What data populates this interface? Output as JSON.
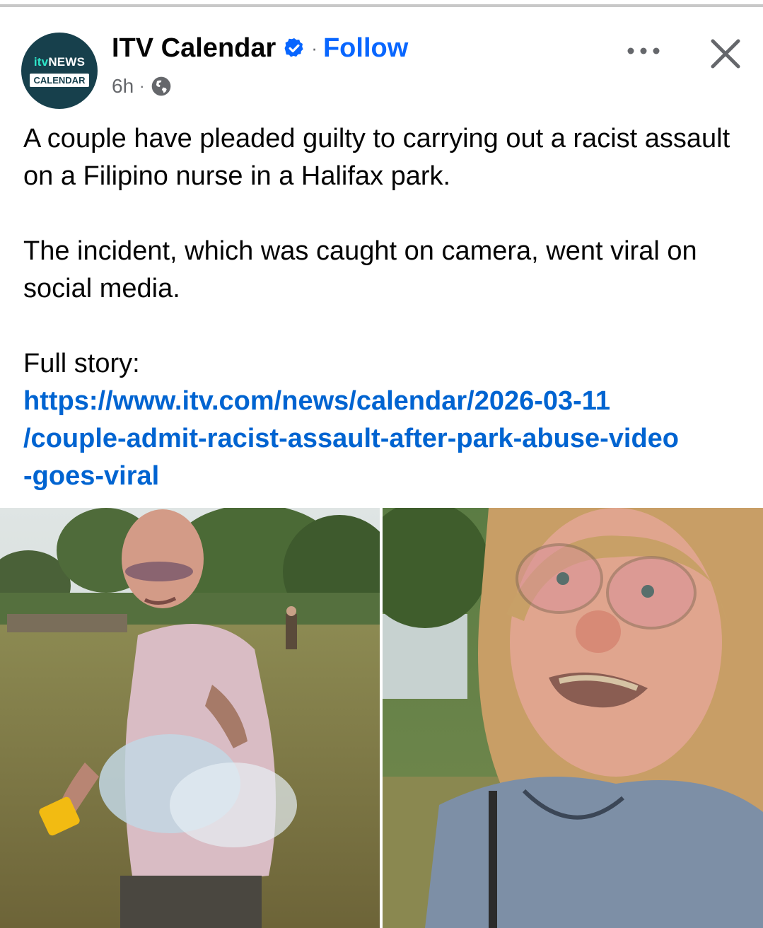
{
  "post": {
    "author": {
      "name": "ITV Calendar",
      "avatar_top": "NEWS",
      "avatar_top_brand": "itv",
      "avatar_bottom": "CALENDAR",
      "verified_icon": "verified-badge-icon"
    },
    "separator": "·",
    "follow_label": "Follow",
    "timestamp": "6h",
    "audience_icon": "globe-icon",
    "more_icon": "more-options-icon",
    "close_icon": "close-icon",
    "text": {
      "paragraph1": "A couple have pleaded guilty to carrying out a racist assault on a Filipino nurse in a Halifax park.",
      "paragraph2": "The incident, which was caught on camera, went viral on social media.",
      "paragraph3_label": "Full story:",
      "link_line1": "https://www.itv.com/news/calendar/2026-03-11",
      "link_line2": "/couple-admit-racist-assault-after-park-abuse-video",
      "link_line3": "-goes-viral"
    },
    "media": {
      "left_image": "man-in-park-throwing-water-photo",
      "right_image": "woman-with-glasses-grimacing-photo"
    }
  },
  "colors": {
    "link": "#0064d1",
    "follow": "#0866ff",
    "verified": "#0866ff",
    "secondary_text": "#65676b",
    "avatar_bg": "#17404c"
  }
}
